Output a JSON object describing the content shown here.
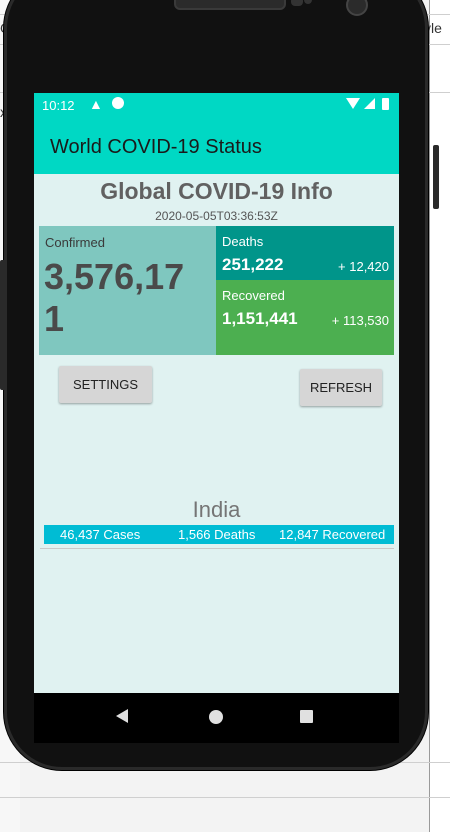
{
  "desktop": {
    "left_text_1": "G",
    "left_text_2": "x",
    "right_text": "yle"
  },
  "status_bar": {
    "time": "10:12",
    "icons": [
      "warning-icon",
      "app-notification-icon",
      "wifi-icon",
      "signal-icon",
      "battery-icon"
    ]
  },
  "app_bar": {
    "title": "World COVID-19 Status"
  },
  "global": {
    "title": "Global COVID-19 Info",
    "timestamp": "2020-05-05T03:36:53Z",
    "confirmed": {
      "label": "Confirmed",
      "value": "3,576,171"
    },
    "deaths": {
      "label": "Deaths",
      "value": "251,222",
      "delta": "+ 12,420"
    },
    "recovered": {
      "label": "Recovered",
      "value": "1,151,441",
      "delta": "+ 113,530"
    }
  },
  "buttons": {
    "settings": "SETTINGS",
    "refresh": "REFRESH"
  },
  "country": {
    "name": "India",
    "cases": "46,437 Cases",
    "deaths": "1,566 Deaths",
    "recovered": "12,847 Recovered"
  },
  "colors": {
    "app_bar": "#00d8c4",
    "background": "#e0f2f1",
    "confirmed": "#7fc7bf",
    "deaths": "#00958a",
    "recovered": "#4caf50",
    "country_bar": "#00bcd4"
  },
  "nav_icons": [
    "back-icon",
    "home-icon",
    "recents-icon"
  ]
}
